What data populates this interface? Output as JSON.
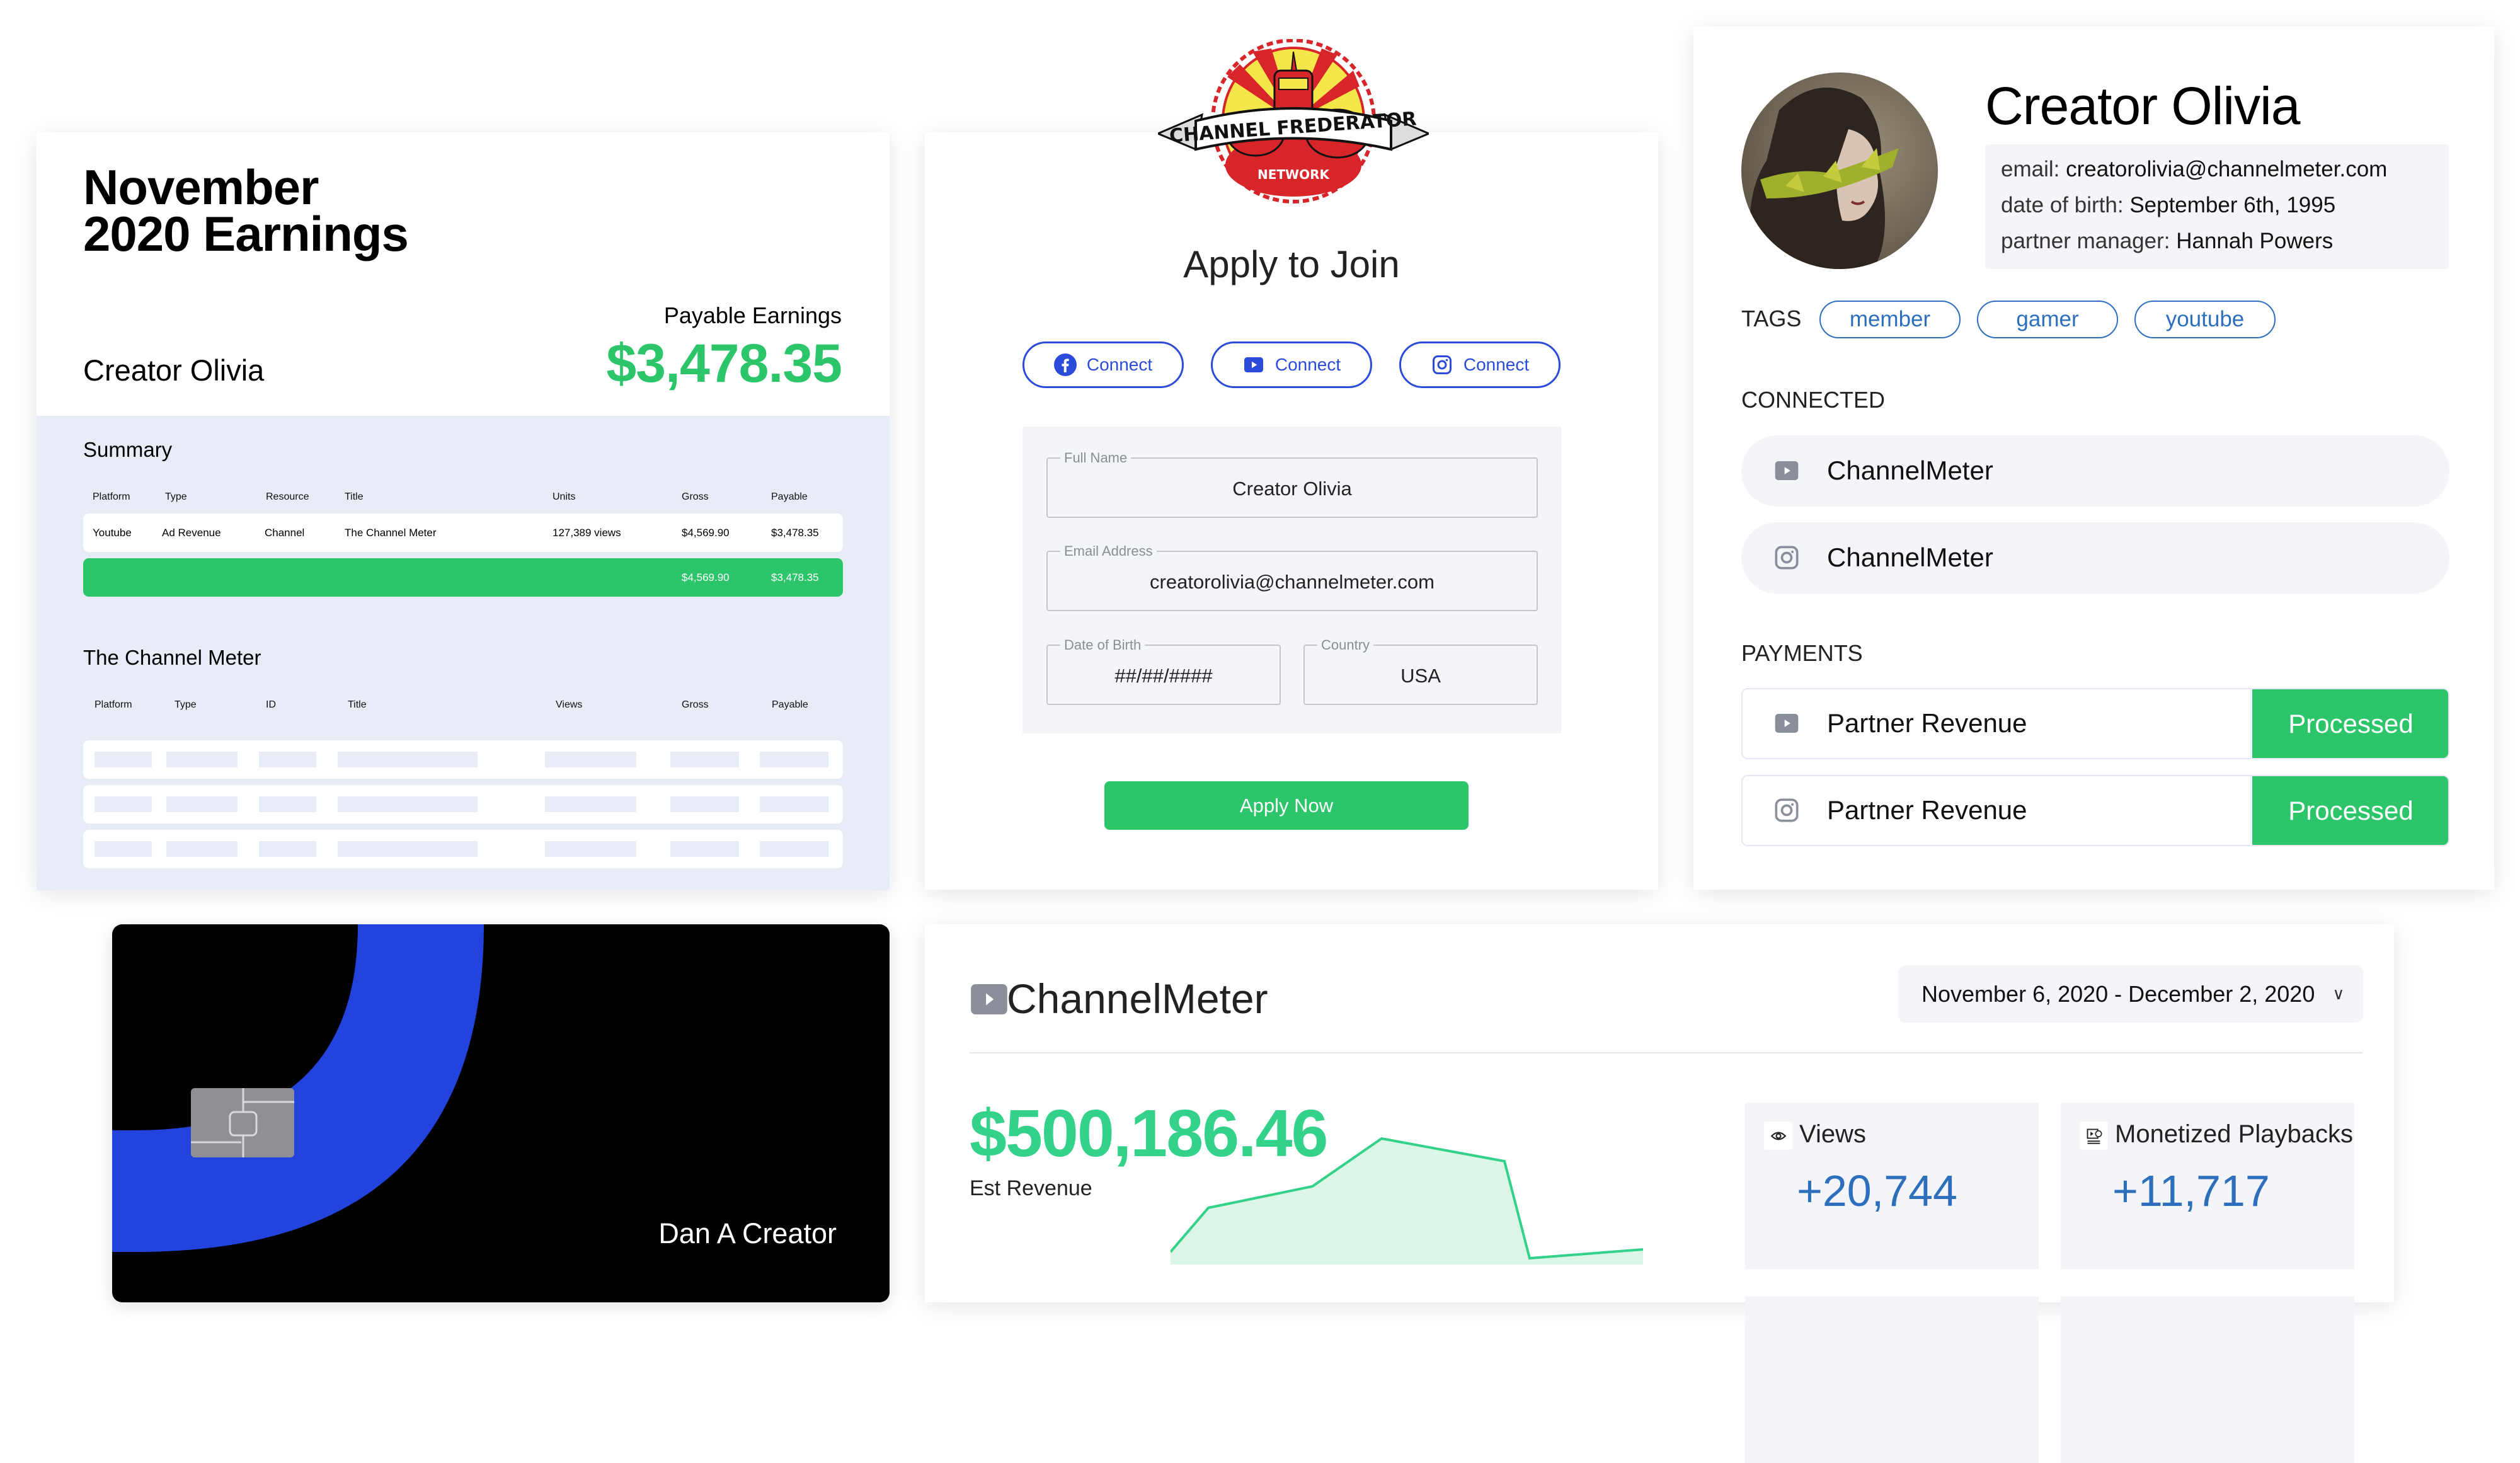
{
  "earnings": {
    "title_line1": "November",
    "title_line2": "2020 Earnings",
    "creator_name": "Creator Olivia",
    "payable_label": "Payable Earnings",
    "payable_value": "$3,478.35",
    "summary": {
      "title": "Summary",
      "headers": [
        "Platform",
        "Type",
        "Resource",
        "Title",
        "Units",
        "Gross",
        "Payable"
      ],
      "rows": [
        [
          "Youtube",
          "Ad Revenue",
          "Channel",
          "The Channel Meter",
          "127,389 views",
          "$4,569.90",
          "$3,478.35"
        ]
      ],
      "totals": {
        "gross": "$4,569.90",
        "payable": "$3,478.35"
      }
    },
    "channel_table": {
      "title": "The Channel Meter",
      "headers": [
        "Platform",
        "Type",
        "ID",
        "Title",
        "Views",
        "Gross",
        "Payable"
      ],
      "placeholder_rows": 3
    }
  },
  "apply": {
    "logo_text_top": "CHANNEL FREDERATOR",
    "logo_text_bottom": "NETWORK",
    "heading": "Apply to Join",
    "connect_buttons": [
      {
        "platform": "facebook",
        "icon": "facebook-icon",
        "label": "Connect"
      },
      {
        "platform": "youtube",
        "icon": "youtube-icon",
        "label": "Connect"
      },
      {
        "platform": "instagram",
        "icon": "instagram-icon",
        "label": "Connect"
      }
    ],
    "fields": {
      "full_name": {
        "label": "Full Name",
        "value": "Creator Olivia"
      },
      "email": {
        "label": "Email Address",
        "value": "creatorolivia@channelmeter.com"
      },
      "dob": {
        "label": "Date of Birth",
        "value": "##/##/####"
      },
      "country": {
        "label": "Country",
        "value": "USA"
      }
    },
    "submit_label": "Apply Now"
  },
  "profile": {
    "name": "Creator Olivia",
    "email_label": "email:",
    "email": "creatorolivia@channelmeter.com",
    "dob_label": "date of birth:",
    "dob": "September 6th, 1995",
    "manager_label": "partner manager:",
    "manager": "Hannah Powers",
    "tags_label": "TAGS",
    "tags": [
      "member",
      "gamer",
      "youtube"
    ],
    "connected_label": "CONNECTED",
    "connected": [
      {
        "icon": "youtube-icon",
        "name": "ChannelMeter"
      },
      {
        "icon": "instagram-icon",
        "name": "ChannelMeter"
      }
    ],
    "payments_label": "PAYMENTS",
    "payments": [
      {
        "icon": "youtube-icon",
        "name": "Partner Revenue",
        "status": "Processed"
      },
      {
        "icon": "instagram-icon",
        "name": "Partner Revenue",
        "status": "Processed"
      }
    ]
  },
  "bank_card": {
    "holder": "Dan A Creator"
  },
  "channelmeter": {
    "title": "ChannelMeter",
    "date_range": "November 6, 2020 - December 2, 2020",
    "est_revenue": "$500,186.46",
    "est_revenue_label": "Est Revenue",
    "stats": [
      {
        "icon": "eye-icon",
        "label": "Views",
        "value": "+20,744"
      },
      {
        "icon": "monetized-playback-icon",
        "label": "Monetized Playbacks",
        "value": "+11,717"
      }
    ]
  },
  "colors": {
    "green": "#2cc56a",
    "revenue_green": "#33d18a",
    "blue_accent": "#2b4bd8",
    "tag_blue": "#2d6fbd",
    "card_blue": "#2243dd",
    "panel_gray": "#f3f5f9",
    "summary_bg": "#e8ecf6"
  },
  "chart_data": {
    "type": "area",
    "title": "Est Revenue",
    "x": [
      0,
      1,
      2,
      3,
      4,
      5,
      6
    ],
    "values": [
      10,
      45,
      62,
      100,
      82,
      5,
      12
    ],
    "xlabel": "",
    "ylabel": "",
    "ylim": [
      0,
      110
    ],
    "grid": false,
    "legend": "none",
    "note": "Partially visible sparkline; relative values estimated"
  }
}
